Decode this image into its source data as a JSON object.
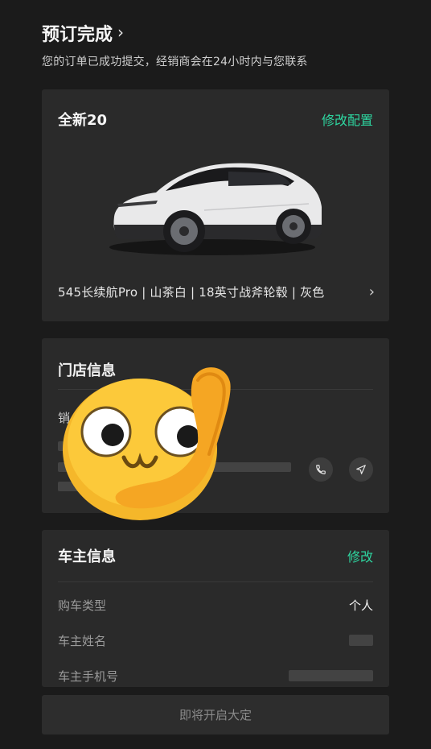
{
  "header": {
    "title": "预订完成",
    "subtitle": "您的订单已成功提交，经销商会在24小时内与您联系"
  },
  "car_card": {
    "model": "全新20",
    "modify_config": "修改配置",
    "config_summary": "545长续航Pro | 山茶白 | 18英寸战斧轮毂 | 灰色"
  },
  "store_card": {
    "title": "门店信息",
    "first_char": "销"
  },
  "owner_card": {
    "title": "车主信息",
    "modify": "修改",
    "rows": [
      {
        "label": "购车类型",
        "value": "个人"
      },
      {
        "label": "车主姓名",
        "value": ""
      },
      {
        "label": "车主手机号",
        "value": ""
      }
    ]
  },
  "bottom": {
    "button_label": "即将开启大定"
  },
  "colors": {
    "accent": "#2ed6a0",
    "background": "#1b1b1b",
    "card": "#2a2a2a"
  },
  "icons": [
    "chevron-right-icon",
    "phone-icon",
    "navigate-icon",
    "thinking-face-emoji"
  ]
}
